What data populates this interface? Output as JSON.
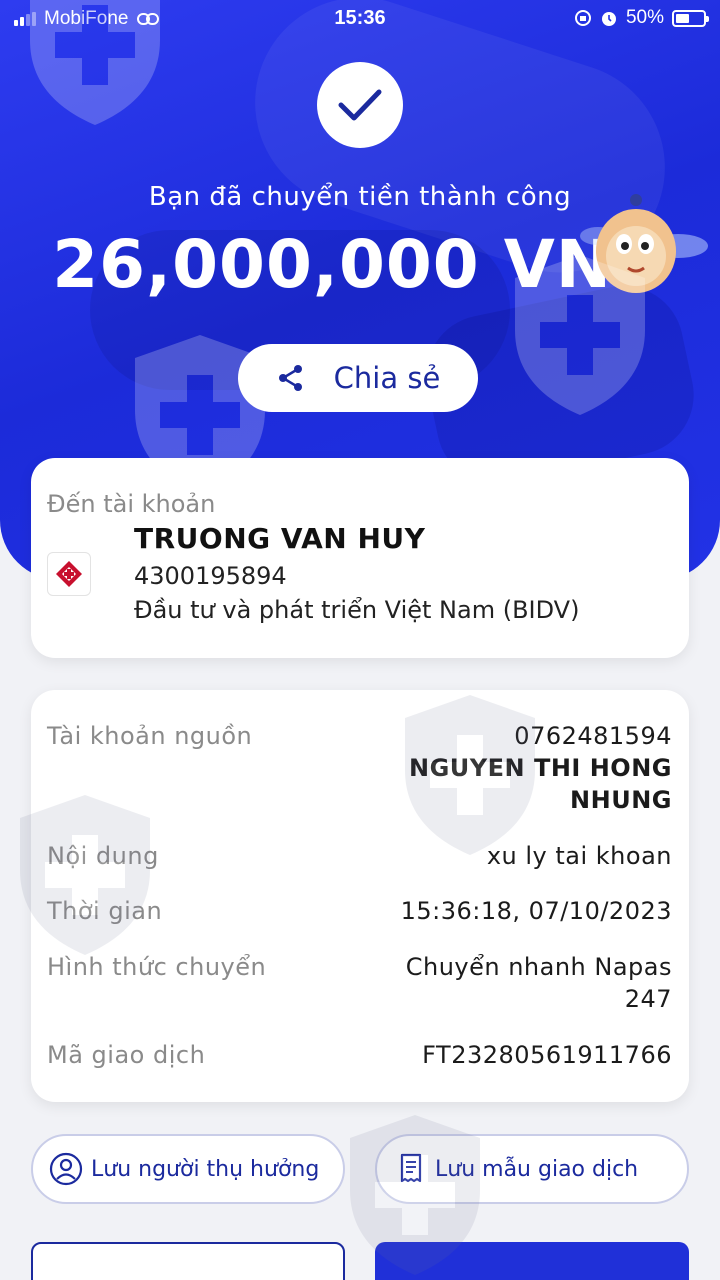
{
  "status_bar": {
    "carrier": "MobiFone",
    "time": "15:36",
    "battery": "50%"
  },
  "hero": {
    "success_message": "Bạn đã chuyển tiền thành công",
    "amount": "26,000,000 VND",
    "share_label": "Chia sẻ"
  },
  "destination": {
    "label": "Đến tài khoản",
    "name": "TRUONG VAN HUY",
    "account_number": "4300195894",
    "bank": "Đầu tư và phát triển Việt Nam (BIDV)"
  },
  "details": {
    "source_label": "Tài khoản nguồn",
    "source_account": "0762481594",
    "source_name_line1": "NGUYEN THI HONG",
    "source_name_line2": "NHUNG",
    "content_label": "Nội dung",
    "content_value": "xu ly tai khoan",
    "time_label": "Thời gian",
    "time_value": "15:36:18, 07/10/2023",
    "method_label": "Hình thức chuyển",
    "method_value_line1": "Chuyển nhanh Napas",
    "method_value_line2": "247",
    "txn_label": "Mã giao dịch",
    "txn_value": "FT23280561911766"
  },
  "actions": {
    "save_beneficiary": "Lưu người thụ hưởng",
    "save_template": "Lưu mẫu giao dịch"
  },
  "colors": {
    "primary": "#2232e6",
    "accent_text": "#1b2a9e",
    "background": "#f1f2f6"
  }
}
